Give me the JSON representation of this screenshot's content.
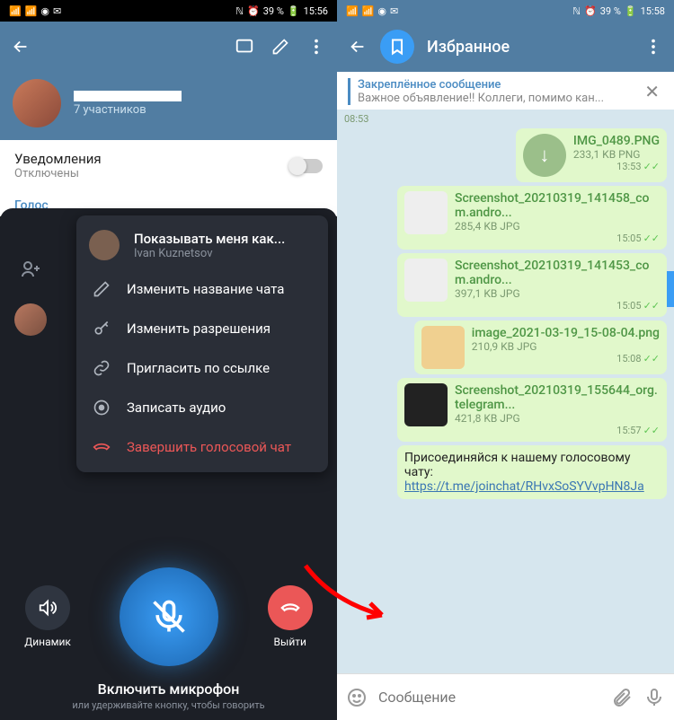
{
  "left": {
    "status": {
      "battery": "39 %",
      "time": "15:56"
    },
    "header": {
      "participants": "7 участников"
    },
    "notif": {
      "title": "Уведомления",
      "sub": "Отключены"
    },
    "voice_section": "Голос",
    "menu": {
      "show_as": "Показывать меня как...",
      "show_as_sub": "Ivan Kuznetsov",
      "rename": "Изменить название чата",
      "permissions": "Изменить разрешения",
      "invite": "Пригласить по ссылке",
      "record": "Записать аудио",
      "end": "Завершить голосовой чат"
    },
    "controls": {
      "speaker": "Динамик",
      "leave": "Выйти"
    },
    "mic_footer": {
      "title": "Включить микрофон",
      "sub": "или удерживайте кнопку, чтобы говорить"
    }
  },
  "right": {
    "status": {
      "battery": "39 %",
      "time": "15:58"
    },
    "title": "Избранное",
    "pinned": {
      "title": "Закреплённое сообщение",
      "text": "Важное объявление!! Коллеги, помимо кан..."
    },
    "messages": [
      {
        "time": "08:53"
      },
      {
        "name": "IMG_0489.PNG",
        "meta": "233,1 KB PNG",
        "time": "13:53"
      },
      {
        "name": "Screenshot_20210319_141458_com.andro...",
        "meta": "285,4 KB JPG",
        "time": "15:05"
      },
      {
        "name": "Screenshot_20210319_141453_com.andro...",
        "meta": "397,1 KB JPG",
        "time": "15:05"
      },
      {
        "name": "image_2021-03-19_15-08-04.png",
        "meta": "210,9 KB JPG",
        "time": "15:08"
      },
      {
        "name": "Screenshot_20210319_155644_org.telegram...",
        "meta": "421,8 KB JPG",
        "time": "15:57"
      }
    ],
    "link_msg": {
      "prefix": "Присоединяйся к нашему голосовому чату: ",
      "url": "https://t.me/joinchat/RHvxSoSYVvpHN8Ja"
    },
    "compose_placeholder": "Сообщение"
  }
}
